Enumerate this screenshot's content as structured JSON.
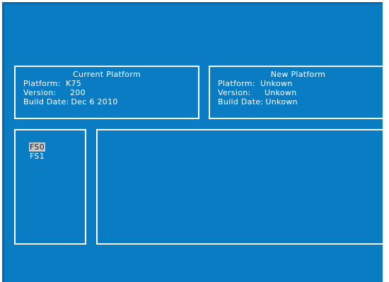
{
  "current": {
    "title": "Current Platform",
    "platform_label": "Platform:",
    "platform_value": "K75",
    "version_label": "Version:",
    "version_value": "200",
    "build_label": "Build Date:",
    "build_value": "Dec 6 2010"
  },
  "new": {
    "title": "New Platform",
    "platform_label": "Platform:",
    "platform_value": "Unkown",
    "version_label": "Version:",
    "version_value": "Unkown",
    "build_label": "Build Date:",
    "build_value": "Unkown"
  },
  "filesystems": {
    "items": [
      "FS0",
      "FS1"
    ],
    "selected": "FS0"
  },
  "colors": {
    "background": "#0a7cc4",
    "border": "#ffffff",
    "text": "#ffffff",
    "selection": "#c9c9c9"
  }
}
